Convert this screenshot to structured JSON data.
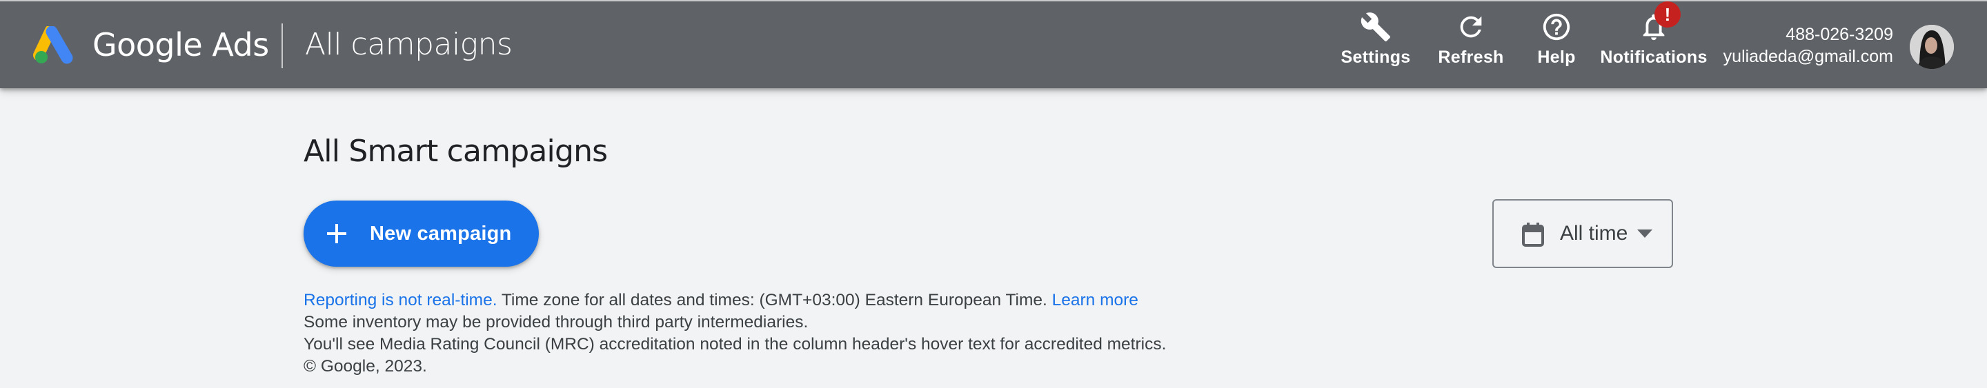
{
  "header": {
    "brand": "Google Ads",
    "context_title": "All campaigns",
    "tools": [
      {
        "id": "settings",
        "label": "Settings",
        "icon": "wrench-icon"
      },
      {
        "id": "refresh",
        "label": "Refresh",
        "icon": "refresh-icon"
      },
      {
        "id": "help",
        "label": "Help",
        "icon": "help-circle-icon"
      },
      {
        "id": "notifications",
        "label": "Notifications",
        "icon": "bell-icon",
        "badge": "!"
      }
    ],
    "account": {
      "customer_id": "488-026-3209",
      "email": "yuliadeda@gmail.com"
    },
    "colors": {
      "bar": "#5f6368",
      "badge": "#c5221f"
    }
  },
  "main": {
    "title": "All Smart campaigns",
    "new_campaign_button": {
      "label": "New campaign",
      "icon": "plus-icon"
    },
    "date_range": {
      "selected": "All time",
      "icon": "calendar-icon"
    },
    "footer": {
      "reporting_link": "Reporting is not real-time.",
      "timezone_text": " Time zone for all dates and times: (GMT+03:00) Eastern European Time. ",
      "learn_more_link": "Learn more",
      "inventory_note": "Some inventory may be provided through third party intermediaries.",
      "mrc_note": "You'll see Media Rating Council (MRC) accreditation noted in the column header's hover text for accredited metrics.",
      "copyright": "© Google, 2023."
    },
    "colors": {
      "accent": "#1a73e8",
      "background": "#f1f3f4"
    }
  }
}
